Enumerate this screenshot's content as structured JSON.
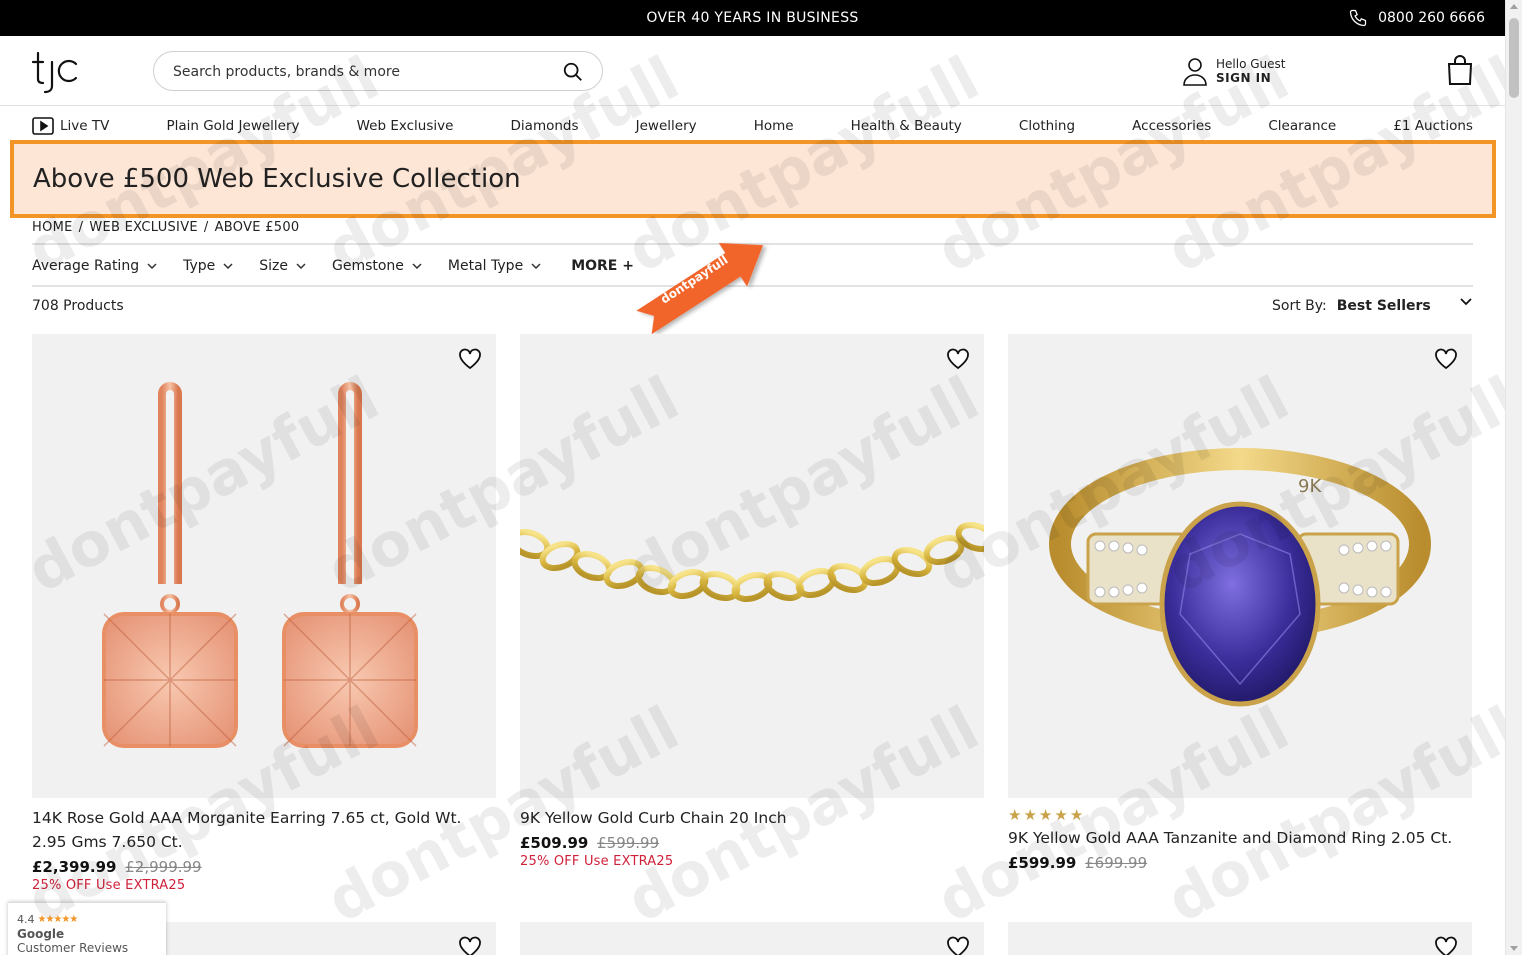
{
  "topbar": {
    "message": "OVER 40 YEARS IN BUSINESS",
    "phone": "0800 260 6666"
  },
  "header": {
    "logo_text": "tjc",
    "search_placeholder": "Search products, brands & more",
    "account_greeting": "Hello Guest",
    "account_action": "SIGN IN"
  },
  "nav": {
    "items": [
      {
        "label": "Live TV"
      },
      {
        "label": "Plain Gold Jewellery"
      },
      {
        "label": "Web Exclusive"
      },
      {
        "label": "Diamonds"
      },
      {
        "label": "Jewellery"
      },
      {
        "label": "Home"
      },
      {
        "label": "Health & Beauty"
      },
      {
        "label": "Clothing"
      },
      {
        "label": "Accessories"
      },
      {
        "label": "Clearance"
      },
      {
        "label": "£1 Auctions"
      }
    ]
  },
  "banner": {
    "title": "Above £500 Web Exclusive Collection",
    "highlight_color": "#f39426"
  },
  "breadcrumb": {
    "items": [
      "HOME",
      "WEB EXCLUSIVE",
      "ABOVE £500"
    ],
    "separator": "/"
  },
  "filters": {
    "items": [
      "Average Rating",
      "Type",
      "Size",
      "Gemstone",
      "Metal Type"
    ],
    "more_label": "MORE +"
  },
  "promo_arrow": {
    "text": "dontpayfull",
    "color": "#f2652a"
  },
  "listing": {
    "count": "708 Products",
    "sort_label": "Sort By:",
    "sort_value": "Best Sellers"
  },
  "products": [
    {
      "title": "14K Rose Gold AAA Morganite Earring 7.65 ct, Gold Wt. 2.95 Gms 7.650 Ct.",
      "price": "£2,399.99",
      "was_price": "£2,999.99",
      "offer": "25% OFF Use EXTRA25",
      "rating": null
    },
    {
      "title": "9K Yellow Gold Curb Chain 20 Inch",
      "price": "£509.99",
      "was_price": "£599.99",
      "offer": "25% OFF Use EXTRA25",
      "rating": null
    },
    {
      "title": "9K Yellow Gold AAA Tanzanite and Diamond Ring 2.05 Ct.",
      "price": "£599.99",
      "was_price": "£699.99",
      "offer": "",
      "rating": 5,
      "ring_stamp": "9K"
    }
  ],
  "google_badge": {
    "rating": "4.4",
    "brand": "Google",
    "label": "Customer Reviews"
  },
  "watermark": "dontpayfull",
  "colors": {
    "offer_red": "#d0213a",
    "star_gold": "#c9a24a",
    "banner_bg": "#fde6d6"
  }
}
